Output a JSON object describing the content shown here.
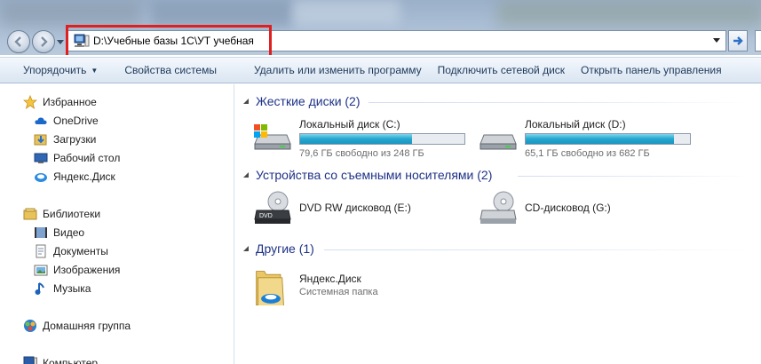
{
  "address_bar": {
    "path": "D:\\Учебные базы 1С\\УТ учебная"
  },
  "toolbar": {
    "items": [
      {
        "label": "Упорядочить",
        "has_dropdown": true
      },
      {
        "label": "Свойства системы"
      },
      {
        "label": "Удалить или изменить программу"
      },
      {
        "label": "Подключить сетевой диск"
      },
      {
        "label": "Открыть панель управления"
      }
    ]
  },
  "nav": {
    "favorites": {
      "label": "Избранное",
      "items": [
        {
          "label": "OneDrive"
        },
        {
          "label": "Загрузки"
        },
        {
          "label": "Рабочий стол"
        },
        {
          "label": "Яндекс.Диск"
        }
      ]
    },
    "libraries": {
      "label": "Библиотеки",
      "items": [
        {
          "label": "Видео"
        },
        {
          "label": "Документы"
        },
        {
          "label": "Изображения"
        },
        {
          "label": "Музыка"
        }
      ]
    },
    "homegroup": {
      "label": "Домашняя группа"
    },
    "computer": {
      "label": "Компьютер"
    }
  },
  "content": {
    "hard_drives": {
      "header": "Жесткие диски (2)",
      "drives": [
        {
          "name": "Локальный диск (C:)",
          "free_text": "79,6 ГБ свободно из 248 ГБ",
          "used_fraction": 0.68
        },
        {
          "name": "Локальный диск (D:)",
          "free_text": "65,1 ГБ свободно из 682 ГБ",
          "used_fraction": 0.9
        }
      ]
    },
    "removable": {
      "header": "Устройства со съемными носителями (2)",
      "drives": [
        {
          "name": "DVD RW дисковод (E:)"
        },
        {
          "name": "CD-дисковод (G:)"
        }
      ]
    },
    "other": {
      "header": "Другие (1)",
      "items": [
        {
          "name": "Яндекс.Диск",
          "subtitle": "Системная папка"
        }
      ]
    }
  },
  "colors": {
    "group_header": "#1e3287",
    "toolbar_text": "#1e395b",
    "capacity_bar": "#26a7d0",
    "highlight_box": "#e02020"
  }
}
